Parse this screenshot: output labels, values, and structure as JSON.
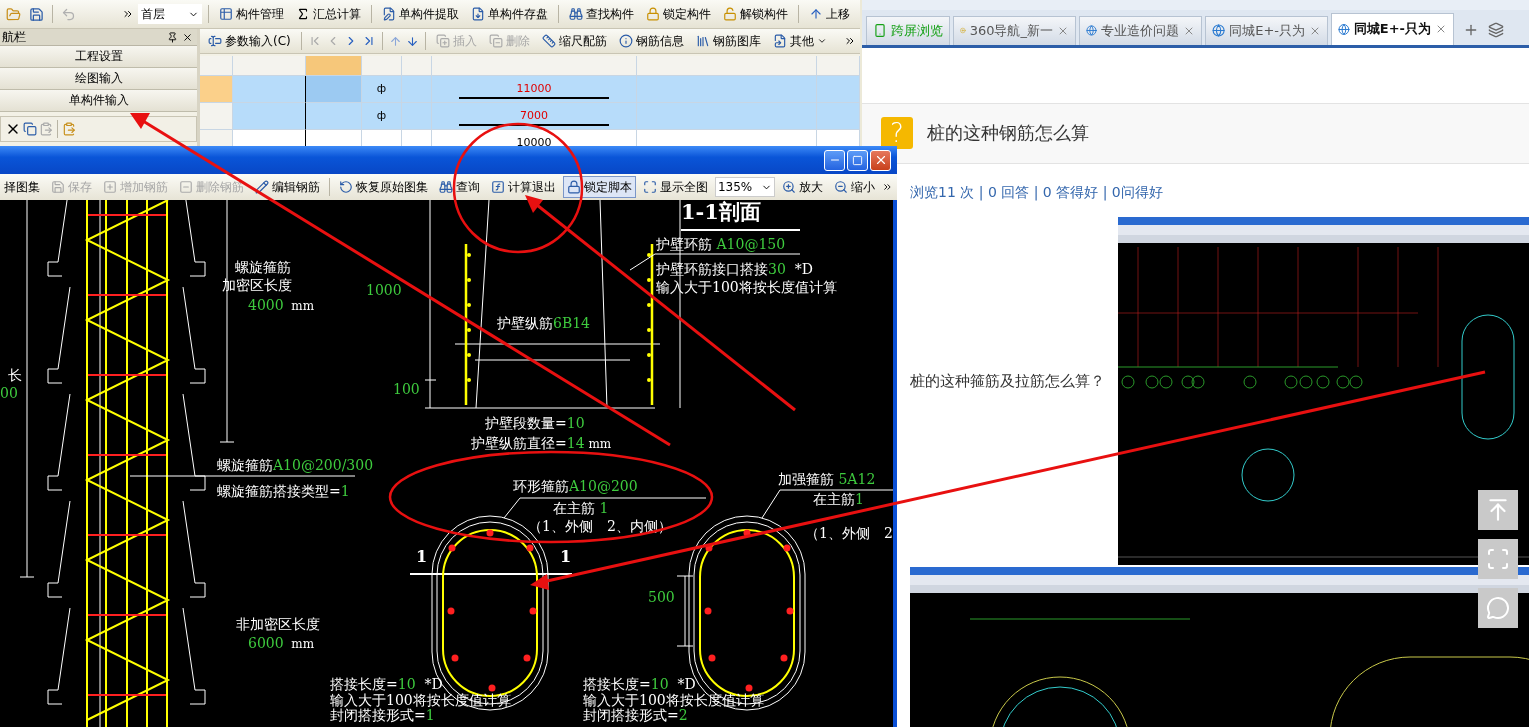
{
  "app": {
    "toolbar": {
      "floor": "首层",
      "buttons": [
        {
          "label": "构件管理"
        },
        {
          "label": "汇总计算"
        },
        {
          "label": "单构件提取"
        },
        {
          "label": "单构件存盘"
        },
        {
          "label": "查找构件"
        },
        {
          "label": "锁定构件"
        },
        {
          "label": "解锁构件"
        },
        {
          "label": "上移"
        }
      ]
    },
    "nav": {
      "title": "航栏",
      "items": [
        "工程设置",
        "绘图输入",
        "单构件输入"
      ]
    },
    "param_toolbar": {
      "buttons": [
        {
          "label": "参数输入(C)",
          "disabled": false
        },
        {
          "label": "插入",
          "disabled": true
        },
        {
          "label": "删除",
          "disabled": true
        },
        {
          "label": "缩尺配筋",
          "disabled": false
        },
        {
          "label": "钢筋信息",
          "disabled": false
        },
        {
          "label": "钢筋图库",
          "disabled": false
        },
        {
          "label": "其他",
          "disabled": false
        }
      ]
    },
    "grid": {
      "rows": [
        {
          "symbol": "ф",
          "length": "11000",
          "selected": true,
          "highlighted": true
        },
        {
          "symbol": "ф",
          "length": "7000",
          "selected": false,
          "highlighted": true
        },
        {
          "length": "10000",
          "selected": false,
          "highlighted": false
        }
      ]
    }
  },
  "dialog": {
    "buttons": [
      {
        "label": "择图集",
        "disabled": false,
        "pressed": false
      },
      {
        "label": "保存",
        "disabled": true,
        "pressed": false
      },
      {
        "label": "增加钢筋",
        "disabled": true,
        "pressed": false
      },
      {
        "label": "删除钢筋",
        "disabled": true,
        "pressed": false
      },
      {
        "label": "编辑钢筋",
        "disabled": false,
        "pressed": false
      },
      {
        "label": "恢复原始图集",
        "disabled": false,
        "pressed": false
      },
      {
        "label": "查询",
        "disabled": false,
        "pressed": false
      },
      {
        "label": "计算退出",
        "disabled": false,
        "pressed": false
      },
      {
        "label": "锁定脚本",
        "disabled": false,
        "pressed": true
      },
      {
        "label": "显示全图",
        "disabled": false,
        "pressed": false
      }
    ],
    "zoom": "135%",
    "zoom_buttons": [
      "放大",
      "缩小"
    ],
    "labels": [
      {
        "kind": "note",
        "parts": [
          {
            "kind": "text",
            "text": "长"
          }
        ]
      },
      {
        "kind": "note",
        "parts": [
          {
            "kind": "value",
            "text": "00"
          }
        ]
      },
      {
        "kind": "note",
        "parts": [
          {
            "kind": "text",
            "text": "螺旋箍筋"
          }
        ]
      },
      {
        "kind": "note",
        "parts": [
          {
            "kind": "text",
            "text": "加密区长度"
          }
        ]
      },
      {
        "kind": "note",
        "parts": [
          {
            "kind": "value",
            "text": "4000"
          },
          {
            "kind": "unit",
            "text": "  mm"
          }
        ]
      },
      {
        "kind": "note",
        "parts": [
          {
            "kind": "value",
            "text": "1000"
          }
        ]
      },
      {
        "kind": "note",
        "parts": [
          {
            "kind": "value",
            "text": "100"
          }
        ]
      },
      {
        "kind": "heading",
        "parts": [
          {
            "kind": "text",
            "text": "1-1剖面"
          }
        ]
      },
      {
        "kind": "note",
        "parts": [
          {
            "kind": "text",
            "text": "护壁环筋 "
          },
          {
            "kind": "value",
            "text": "A10@150"
          }
        ]
      },
      {
        "kind": "note",
        "parts": [
          {
            "kind": "text",
            "text": "护壁环筋接口搭接"
          },
          {
            "kind": "value",
            "text": "30"
          },
          {
            "kind": "text",
            "text": "  *D"
          }
        ]
      },
      {
        "kind": "note",
        "parts": [
          {
            "kind": "text",
            "text": "输入大于100将按长度值计算"
          }
        ]
      },
      {
        "kind": "note",
        "parts": [
          {
            "kind": "text",
            "text": "护壁纵筋"
          },
          {
            "kind": "value",
            "text": "6B14"
          }
        ]
      },
      {
        "kind": "note",
        "parts": [
          {
            "kind": "text",
            "text": "护壁段数量="
          },
          {
            "kind": "value",
            "text": "10"
          }
        ]
      },
      {
        "kind": "note",
        "parts": [
          {
            "kind": "text",
            "text": "护壁纵筋直径="
          },
          {
            "kind": "value",
            "text": "14"
          },
          {
            "kind": "unit",
            "text": " mm"
          }
        ]
      },
      {
        "kind": "note",
        "parts": [
          {
            "kind": "text",
            "text": "螺旋箍筋"
          },
          {
            "kind": "value",
            "text": "A10@200/300"
          }
        ]
      },
      {
        "kind": "note",
        "parts": [
          {
            "kind": "text",
            "text": "螺旋箍筋搭接类型="
          },
          {
            "kind": "value",
            "text": "1"
          }
        ]
      },
      {
        "kind": "note",
        "parts": [
          {
            "kind": "text",
            "text": "环形箍筋"
          },
          {
            "kind": "value",
            "text": "A10@200"
          }
        ]
      },
      {
        "kind": "note",
        "parts": [
          {
            "kind": "text",
            "text": "在主筋 "
          },
          {
            "kind": "value",
            "text": "1"
          }
        ]
      },
      {
        "kind": "note",
        "parts": [
          {
            "kind": "text",
            "text": "（1、外侧　2、内侧）"
          }
        ]
      },
      {
        "kind": "mark",
        "parts": [
          {
            "kind": "text",
            "text": "1"
          }
        ]
      },
      {
        "kind": "mark",
        "parts": [
          {
            "kind": "text",
            "text": "1"
          }
        ]
      },
      {
        "kind": "note",
        "parts": [
          {
            "kind": "text",
            "text": "加强箍筋 "
          },
          {
            "kind": "value",
            "text": "5A12"
          }
        ]
      },
      {
        "kind": "note",
        "parts": [
          {
            "kind": "text",
            "text": "在主筋"
          },
          {
            "kind": "value",
            "text": "1"
          }
        ]
      },
      {
        "kind": "note",
        "parts": [
          {
            "kind": "text",
            "text": "（1、外侧　2"
          }
        ]
      },
      {
        "kind": "note",
        "parts": [
          {
            "kind": "value",
            "text": "500"
          }
        ]
      },
      {
        "kind": "note",
        "parts": [
          {
            "kind": "text",
            "text": "非加密区长度"
          }
        ]
      },
      {
        "kind": "note",
        "parts": [
          {
            "kind": "value",
            "text": "6000"
          },
          {
            "kind": "unit",
            "text": "  mm"
          }
        ]
      },
      {
        "kind": "note",
        "parts": [
          {
            "kind": "text",
            "text": "搭接长度="
          },
          {
            "kind": "value",
            "text": "10"
          },
          {
            "kind": "text",
            "text": "  *D"
          }
        ]
      },
      {
        "kind": "note",
        "parts": [
          {
            "kind": "text",
            "text": "输入大于100将按长度值计算"
          }
        ]
      },
      {
        "kind": "note",
        "parts": [
          {
            "kind": "text",
            "text": "封闭搭接形式="
          },
          {
            "kind": "value",
            "text": "1"
          }
        ]
      },
      {
        "kind": "note",
        "parts": [
          {
            "kind": "text",
            "text": "搭接长度="
          },
          {
            "kind": "value",
            "text": "10"
          },
          {
            "kind": "text",
            "text": "  *D"
          }
        ]
      },
      {
        "kind": "note",
        "parts": [
          {
            "kind": "text",
            "text": "输入大于100将按长度值计算"
          }
        ]
      },
      {
        "kind": "note",
        "parts": [
          {
            "kind": "text",
            "text": "封闭搭接形式="
          },
          {
            "kind": "value",
            "text": "2"
          }
        ]
      }
    ]
  },
  "browser": {
    "tabs": [
      {
        "kind": "tool",
        "label": "跨屏浏览",
        "selected": false
      },
      {
        "kind": "page",
        "label": "360导航_新一",
        "selected": false
      },
      {
        "kind": "page",
        "label": "专业造价问题",
        "selected": false
      },
      {
        "kind": "page",
        "label": "同城E+-只为",
        "selected": false
      },
      {
        "kind": "page",
        "label": "同城E+-只为",
        "selected": true
      }
    ],
    "question": {
      "badge": "?",
      "title": "桩的这种钢筋怎么算",
      "stats": "浏览11 次 | 0 回答 | 0 答得好 | 0问得好",
      "body": "桩的这种箍筋及拉筋怎么算？"
    }
  }
}
